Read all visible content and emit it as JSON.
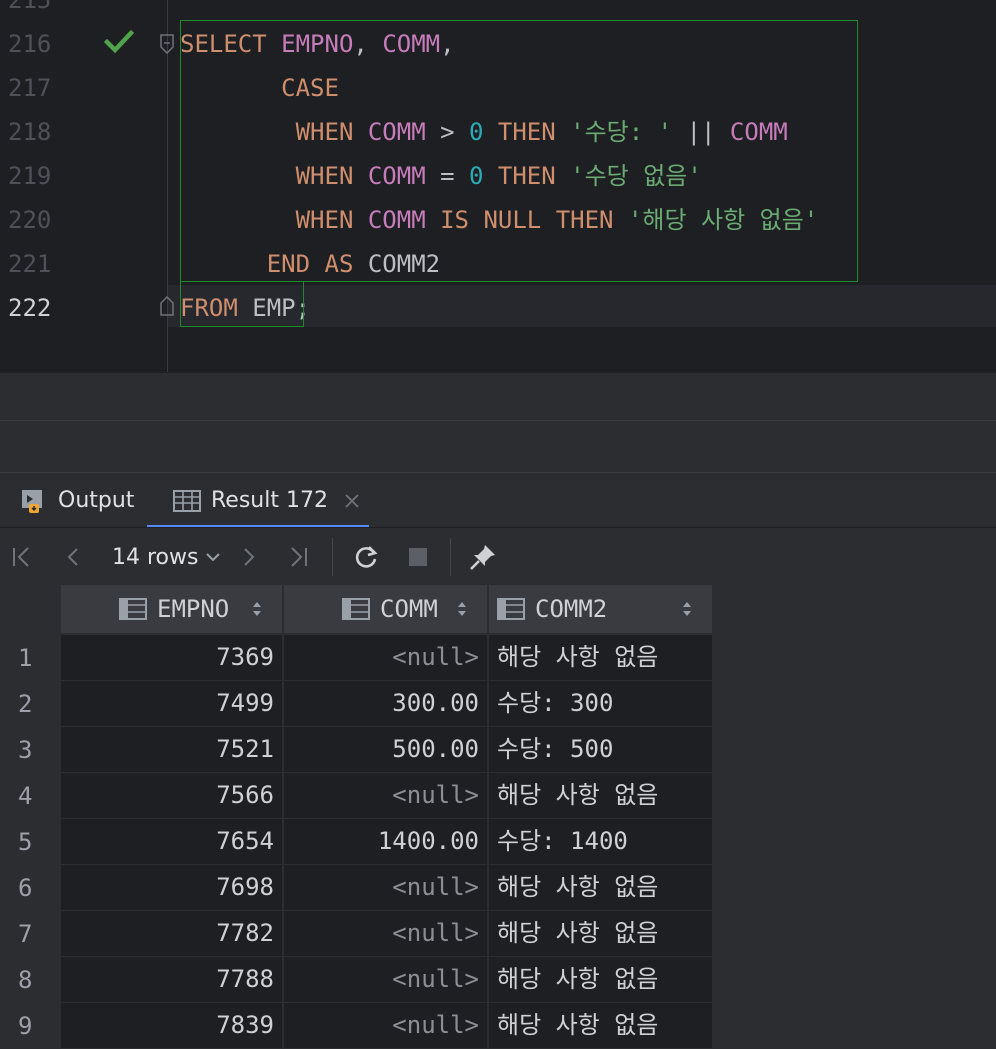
{
  "editor": {
    "line_numbers": [
      "215",
      "216",
      "217",
      "218",
      "219",
      "220",
      "221",
      "222"
    ],
    "lines": [
      [
        {
          "t": "SELECT",
          "c": "kw"
        },
        {
          "t": " ",
          "c": "pl"
        },
        {
          "t": "EMPNO",
          "c": "id"
        },
        {
          "t": ", ",
          "c": "pl"
        },
        {
          "t": "COMM",
          "c": "id"
        },
        {
          "t": ",",
          "c": "pl"
        }
      ],
      [
        {
          "t": "       ",
          "c": "pl"
        },
        {
          "t": "CASE",
          "c": "kw"
        }
      ],
      [
        {
          "t": "        ",
          "c": "pl"
        },
        {
          "t": "WHEN",
          "c": "kw"
        },
        {
          "t": " ",
          "c": "pl"
        },
        {
          "t": "COMM",
          "c": "id"
        },
        {
          "t": " > ",
          "c": "pl"
        },
        {
          "t": "0",
          "c": "num"
        },
        {
          "t": " ",
          "c": "pl"
        },
        {
          "t": "THEN",
          "c": "kw"
        },
        {
          "t": " ",
          "c": "pl"
        },
        {
          "t": "'수당: '",
          "c": "str"
        },
        {
          "t": " || ",
          "c": "pl"
        },
        {
          "t": "COMM",
          "c": "id"
        }
      ],
      [
        {
          "t": "        ",
          "c": "pl"
        },
        {
          "t": "WHEN",
          "c": "kw"
        },
        {
          "t": " ",
          "c": "pl"
        },
        {
          "t": "COMM",
          "c": "id"
        },
        {
          "t": " = ",
          "c": "pl"
        },
        {
          "t": "0",
          "c": "num"
        },
        {
          "t": " ",
          "c": "pl"
        },
        {
          "t": "THEN",
          "c": "kw"
        },
        {
          "t": " ",
          "c": "pl"
        },
        {
          "t": "'수당 없음'",
          "c": "str"
        }
      ],
      [
        {
          "t": "        ",
          "c": "pl"
        },
        {
          "t": "WHEN",
          "c": "kw"
        },
        {
          "t": " ",
          "c": "pl"
        },
        {
          "t": "COMM",
          "c": "id"
        },
        {
          "t": " ",
          "c": "pl"
        },
        {
          "t": "IS NULL",
          "c": "kw"
        },
        {
          "t": " ",
          "c": "pl"
        },
        {
          "t": "THEN",
          "c": "kw"
        },
        {
          "t": " ",
          "c": "pl"
        },
        {
          "t": "'해당 사항 없음'",
          "c": "str"
        }
      ],
      [
        {
          "t": "      ",
          "c": "pl"
        },
        {
          "t": "END AS",
          "c": "kw"
        },
        {
          "t": " COMM2",
          "c": "pl"
        }
      ],
      [
        {
          "t": "FROM",
          "c": "kw"
        },
        {
          "t": " EMP;",
          "c": "pl"
        }
      ]
    ]
  },
  "tabs": {
    "output_label": "Output",
    "result_label": "Result 172"
  },
  "toolbar": {
    "rows_label": "14 rows"
  },
  "grid": {
    "columns": [
      "EMPNO",
      "COMM",
      "COMM2"
    ],
    "rows": [
      {
        "n": "1",
        "empno": "7369",
        "comm": "<null>",
        "comm2": "해당 사항 없음"
      },
      {
        "n": "2",
        "empno": "7499",
        "comm": "300.00",
        "comm2": "수당: 300"
      },
      {
        "n": "3",
        "empno": "7521",
        "comm": "500.00",
        "comm2": "수당: 500"
      },
      {
        "n": "4",
        "empno": "7566",
        "comm": "<null>",
        "comm2": "해당 사항 없음"
      },
      {
        "n": "5",
        "empno": "7654",
        "comm": "1400.00",
        "comm2": "수당: 1400"
      },
      {
        "n": "6",
        "empno": "7698",
        "comm": "<null>",
        "comm2": "해당 사항 없음"
      },
      {
        "n": "7",
        "empno": "7782",
        "comm": "<null>",
        "comm2": "해당 사항 없음"
      },
      {
        "n": "8",
        "empno": "7788",
        "comm": "<null>",
        "comm2": "해당 사항 없음"
      },
      {
        "n": "9",
        "empno": "7839",
        "comm": "<null>",
        "comm2": "해당 사항 없음"
      }
    ]
  },
  "colors": {
    "keyword": "#cf8e6d",
    "identifier": "#c77dbb",
    "number": "#2aacb8",
    "string": "#6aab73",
    "accent": "#548af7",
    "success_check": "#4fa34a",
    "selection_border": "#1f8a2c"
  }
}
